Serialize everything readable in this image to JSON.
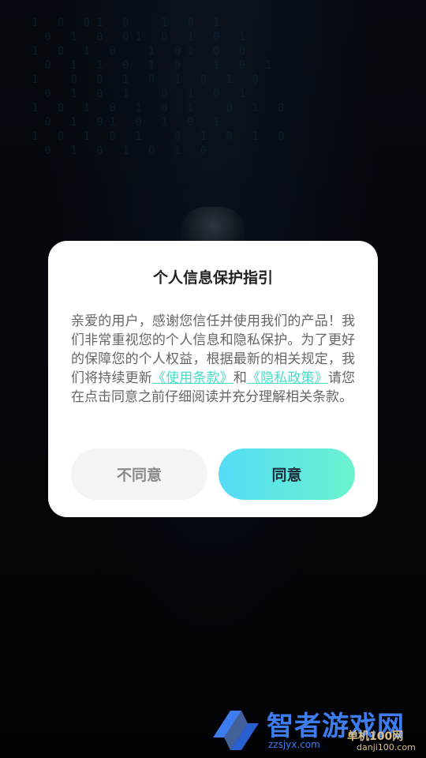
{
  "dialog": {
    "title": "个人信息保护指引",
    "body_before": "亲爱的用户，感谢您信任并使用我们的产品！我们非常重视您的个人信息和隐私保护。为了更好的保障您的个人权益，根据最新的相关规定，我们将持续更新",
    "terms_link": "《使用条款》",
    "and_text": "和",
    "privacy_link": "《隐私政策》",
    "body_after": "请您在点击同意之前仔细阅读并充分理解相关条款。",
    "disagree_label": "不同意",
    "agree_label": "同意"
  },
  "background": {
    "matrix_text": "1 0 01 0  1 0 1\n 0 1 0 01 0 1 0 1\n1 0 1 0  1 01 0 0\n 0 1 1 0 1 0  1 0 1\n1  0 0 1 0 1 0 1 0\n 0 1 0 1  0 1 0 1\n1 0 1 0 1 0 1  0 1 0\n 0 1 01 0 1 0 1\n1 0 1 0 1  0 1 0 1 0\n 0 1 0 1 0 1 0"
  },
  "watermark": {
    "brand": "智者游戏网",
    "domain": "zzsjyx.com",
    "partner": "单机100网",
    "partner_domain": "danji100.com"
  },
  "colors": {
    "link": "#49dcc8",
    "agree_gradient_start": "#55dcf6",
    "agree_gradient_end": "#6af2cf",
    "watermark_blue": "#3d7df0"
  }
}
